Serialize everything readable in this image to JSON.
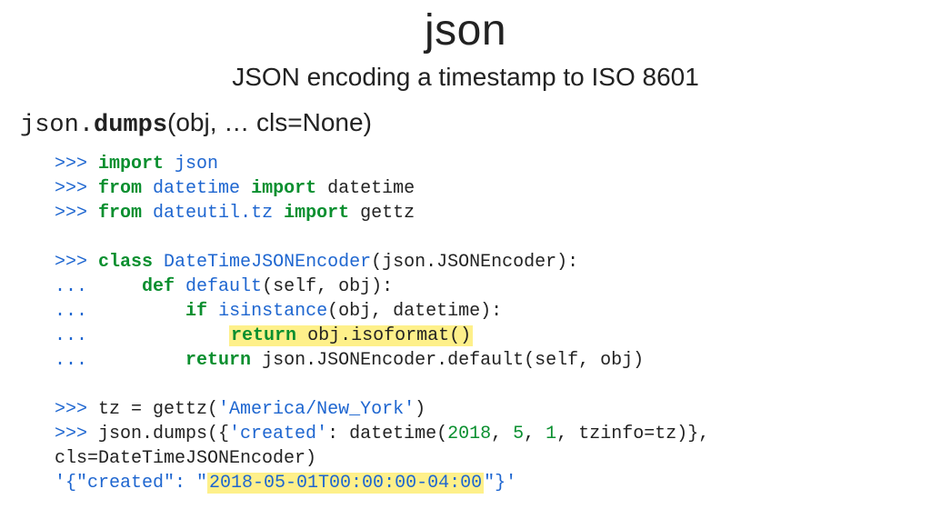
{
  "title": "json",
  "subtitle": "JSON encoding a timestamp to ISO 8601",
  "signature": {
    "module": "json",
    "dot": ".",
    "func": "dumps",
    "rest": "(obj, … cls=None)"
  },
  "code": {
    "l1_import": "import",
    "l1_json": "json",
    "l2_from": "from",
    "l2_datetime1": "datetime",
    "l2_import": "import",
    "l2_datetime2": "datetime",
    "l3_from": "from",
    "l3_mod": "dateutil.tz",
    "l3_import": "import",
    "l3_name": "gettz",
    "l4_class": "class",
    "l4_name": "DateTimeJSONEncoder",
    "l4_rest": "(json.JSONEncoder):",
    "l5_def": "def",
    "l5_name": "default",
    "l5_rest": "(self, obj):",
    "l6_if": "if",
    "l6_call": "isinstance",
    "l6_rest": "(obj, datetime):",
    "l7_ret": "return",
    "l7_obj": "obj",
    "l7_dot": ".",
    "l7_meth": "isoformat()",
    "l8_ret": "return",
    "l8_rest": "json.JSONEncoder.default(self, obj)",
    "l9_lhs": "tz = gettz(",
    "l9_str": "'America/New_York'",
    "l9_rp": ")",
    "l10_a": "json.dumps({",
    "l10_key": "'created'",
    "l10_b": ": datetime(",
    "l10_n1": "2018",
    "l10_c1": ", ",
    "l10_n2": "5",
    "l10_c2": ", ",
    "l10_n3": "1",
    "l10_d": ", tzinfo=tz)},",
    "l11": "cls=DateTimeJSONEncoder)",
    "l12_a": "'{\"created\": \"",
    "l12_hl": "2018-05-01T00:00:00-04:00",
    "l12_b": "\"}'",
    "prompt": ">>> ",
    "cont": "...     "
  }
}
